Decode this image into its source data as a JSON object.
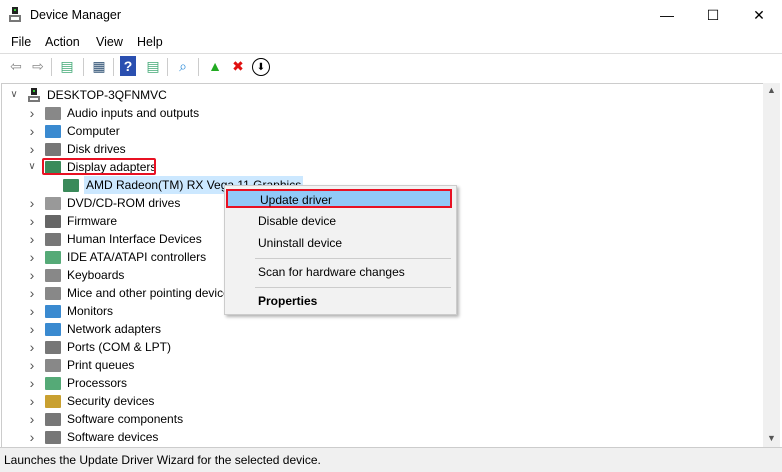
{
  "window": {
    "title": "Device Manager",
    "minimize": "—",
    "maximize": "☐",
    "close": "✕"
  },
  "menu": [
    "File",
    "Action",
    "View",
    "Help"
  ],
  "toolbar": [
    {
      "icon": "back-arrow-icon",
      "glyph": "⇦",
      "color": "#888"
    },
    {
      "icon": "forward-arrow-icon",
      "glyph": "⇨",
      "color": "#888"
    },
    {
      "icon": "show-hide-console-tree-icon",
      "glyph": "▤",
      "color": "#4a7"
    },
    {
      "icon": "properties-icon",
      "glyph": "▦",
      "color": "#357"
    },
    {
      "icon": "help-icon",
      "glyph": "?",
      "color": "#fff"
    },
    {
      "icon": "action-pane-icon",
      "glyph": "▤",
      "color": "#4a7"
    },
    {
      "icon": "scan-hardware-icon",
      "glyph": "⌕",
      "color": "#2a8ad8"
    },
    {
      "icon": "update-driver-icon",
      "glyph": "▲",
      "color": "#2a2"
    },
    {
      "icon": "uninstall-icon",
      "glyph": "✖",
      "color": "#e01010"
    },
    {
      "icon": "disable-device-icon",
      "glyph": "⬇",
      "color": "#000"
    }
  ],
  "tree": {
    "root": "DESKTOP-3QFNMVC",
    "items": [
      {
        "label": "Audio inputs and outputs",
        "icon": "speaker-icon",
        "color": "#888"
      },
      {
        "label": "Computer",
        "icon": "computer-icon",
        "color": "#3a8ad0"
      },
      {
        "label": "Disk drives",
        "icon": "disk-icon",
        "color": "#777"
      },
      {
        "label": "Display adapters",
        "icon": "display-adapter-icon",
        "color": "#3a8a5a",
        "expanded": true,
        "highlighted": true
      },
      {
        "label": "AMD Radeon(TM) RX Vega 11 Graphics",
        "icon": "display-adapter-icon",
        "color": "#3a8a5a",
        "child": true,
        "selected": true
      },
      {
        "label": "DVD/CD-ROM drives",
        "icon": "dvd-icon",
        "color": "#999"
      },
      {
        "label": "Firmware",
        "icon": "firmware-icon",
        "color": "#666"
      },
      {
        "label": "Human Interface Devices",
        "icon": "hid-icon",
        "color": "#777"
      },
      {
        "label": "IDE ATA/ATAPI controllers",
        "icon": "ide-icon",
        "color": "#5a7"
      },
      {
        "label": "Keyboards",
        "icon": "keyboard-icon",
        "color": "#888"
      },
      {
        "label": "Mice and other pointing devices",
        "icon": "mouse-icon",
        "color": "#888"
      },
      {
        "label": "Monitors",
        "icon": "monitor-icon",
        "color": "#3a8ad0"
      },
      {
        "label": "Network adapters",
        "icon": "network-icon",
        "color": "#3a8ad0"
      },
      {
        "label": "Ports (COM & LPT)",
        "icon": "port-icon",
        "color": "#777"
      },
      {
        "label": "Print queues",
        "icon": "printer-icon",
        "color": "#888"
      },
      {
        "label": "Processors",
        "icon": "processor-icon",
        "color": "#5a7"
      },
      {
        "label": "Security devices",
        "icon": "security-icon",
        "color": "#c9a030"
      },
      {
        "label": "Software components",
        "icon": "software-component-icon",
        "color": "#777"
      },
      {
        "label": "Software devices",
        "icon": "software-device-icon",
        "color": "#777"
      }
    ]
  },
  "context_menu": {
    "items": [
      "Update driver",
      "Disable device",
      "Uninstall device",
      "Scan for hardware changes",
      "Properties"
    ]
  },
  "status": "Launches the Update Driver Wizard for the selected device.",
  "colors": {
    "highlight_red": "#e81123",
    "selection": "#cce8ff",
    "menu_hover": "#91c9f7"
  }
}
